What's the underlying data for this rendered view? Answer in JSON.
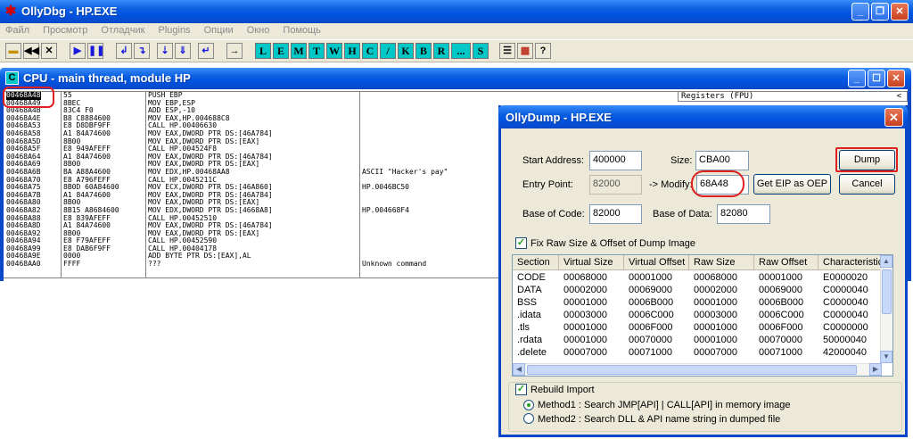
{
  "app": {
    "title": "OllyDbg - HP.EXE",
    "icon": "bug-icon"
  },
  "menu": [
    "Файл",
    "Просмотр",
    "Отладчик",
    "Plugins",
    "Опции",
    "Окно",
    "Помощь"
  ],
  "toolbar": {
    "letters": [
      "L",
      "E",
      "M",
      "T",
      "W",
      "H",
      "C",
      "/",
      "K",
      "B",
      "R",
      "...",
      "S"
    ]
  },
  "cpu_window": {
    "title": "CPU - main thread, module HP",
    "registers_header": "Registers (FPU)",
    "rows": [
      {
        "addr": "00468A48",
        "hex": "55",
        "asm": "PUSH EBP",
        "cmt": ""
      },
      {
        "addr": "00468A49",
        "hex": "8BEC",
        "asm": "MOV EBP,ESP",
        "cmt": ""
      },
      {
        "addr": "00468A4B",
        "hex": "83C4 F0",
        "asm": "ADD ESP,-10",
        "cmt": ""
      },
      {
        "addr": "00468A4E",
        "hex": "B8 C8884600",
        "asm": "MOV EAX,HP.004688C8",
        "cmt": ""
      },
      {
        "addr": "00468A53",
        "hex": "E8 D8DBF9FF",
        "asm": "CALL HP.00406630",
        "cmt": ""
      },
      {
        "addr": "00468A58",
        "hex": "A1 84A74600",
        "asm": "MOV EAX,DWORD PTR DS:[46A784]",
        "cmt": ""
      },
      {
        "addr": "00468A5D",
        "hex": "8B00",
        "asm": "MOV EAX,DWORD PTR DS:[EAX]",
        "cmt": ""
      },
      {
        "addr": "00468A5F",
        "hex": "E8 949AFEFF",
        "asm": "CALL HP.004524F8",
        "cmt": ""
      },
      {
        "addr": "00468A64",
        "hex": "A1 84A74600",
        "asm": "MOV EAX,DWORD PTR DS:[46A784]",
        "cmt": ""
      },
      {
        "addr": "00468A69",
        "hex": "8B00",
        "asm": "MOV EAX,DWORD PTR DS:[EAX]",
        "cmt": ""
      },
      {
        "addr": "00468A6B",
        "hex": "BA A88A4600",
        "asm": "MOV EDX,HP.00468AA8",
        "cmt": "ASCII \"Hacker's pay\""
      },
      {
        "addr": "00468A70",
        "hex": "E8 A796FEFF",
        "asm": "CALL HP.0045211C",
        "cmt": ""
      },
      {
        "addr": "00468A75",
        "hex": "8B0D 60A84600",
        "asm": "MOV ECX,DWORD PTR DS:[46A860]",
        "cmt": "HP.0046BC50"
      },
      {
        "addr": "00468A7B",
        "hex": "A1 84A74600",
        "asm": "MOV EAX,DWORD PTR DS:[46A784]",
        "cmt": ""
      },
      {
        "addr": "00468A80",
        "hex": "8B00",
        "asm": "MOV EAX,DWORD PTR DS:[EAX]",
        "cmt": ""
      },
      {
        "addr": "00468A82",
        "hex": "8B15 A8684600",
        "asm": "MOV EDX,DWORD PTR DS:[4668A8]",
        "cmt": "HP.004668F4"
      },
      {
        "addr": "00468A88",
        "hex": "E8 839AFEFF",
        "asm": "CALL HP.00452510",
        "cmt": ""
      },
      {
        "addr": "00468A8D",
        "hex": "A1 84A74600",
        "asm": "MOV EAX,DWORD PTR DS:[46A784]",
        "cmt": ""
      },
      {
        "addr": "00468A92",
        "hex": "8B00",
        "asm": "MOV EAX,DWORD PTR DS:[EAX]",
        "cmt": ""
      },
      {
        "addr": "00468A94",
        "hex": "E8 F79AFEFF",
        "asm": "CALL HP.00452590",
        "cmt": ""
      },
      {
        "addr": "00468A99",
        "hex": "E8 DAB6F9FF",
        "asm": "CALL HP.00404178",
        "cmt": ""
      },
      {
        "addr": "00468A9E",
        "hex": "0000",
        "asm": "ADD BYTE PTR DS:[EAX],AL",
        "cmt": ""
      },
      {
        "addr": "00468AA0",
        "hex": "FFFF",
        "asm": "???",
        "cmt": "Unknown command"
      }
    ]
  },
  "dump_dialog": {
    "title": "OllyDump - HP.EXE",
    "start_address_label": "Start Address:",
    "start_address": "400000",
    "size_label": "Size:",
    "size": "CBA00",
    "entry_point_label": "Entry Point:",
    "entry_point": "82000",
    "modify_label": "-> Modify:",
    "modify": "68A48",
    "base_of_code_label": "Base of Code:",
    "base_of_code": "82000",
    "base_of_data_label": "Base of Data:",
    "base_of_data": "82080",
    "dump_label": "Dump",
    "cancel_label": "Cancel",
    "get_eip_label": "Get EIP as OEP",
    "fix_raw_label": "Fix Raw Size & Offset of Dump Image",
    "fix_raw_checked": true,
    "columns": [
      "Section",
      "Virtual Size",
      "Virtual Offset",
      "Raw Size",
      "Raw Offset",
      "Characteristic"
    ],
    "sections": [
      [
        "CODE",
        "00068000",
        "00001000",
        "00068000",
        "00001000",
        "E0000020"
      ],
      [
        "DATA",
        "00002000",
        "00069000",
        "00002000",
        "00069000",
        "C0000040"
      ],
      [
        "BSS",
        "00001000",
        "0006B000",
        "00001000",
        "0006B000",
        "C0000040"
      ],
      [
        ".idata",
        "00003000",
        "0006C000",
        "00003000",
        "0006C000",
        "C0000040"
      ],
      [
        ".tls",
        "00001000",
        "0006F000",
        "00001000",
        "0006F000",
        "C0000000"
      ],
      [
        ".rdata",
        "00001000",
        "00070000",
        "00001000",
        "00070000",
        "50000040"
      ],
      [
        ".delete",
        "00007000",
        "00071000",
        "00007000",
        "00071000",
        "42000040"
      ]
    ],
    "rebuild_import_label": "Rebuild Import",
    "rebuild_import_checked": true,
    "method1_label": "Method1 : Search JMP[API] | CALL[API] in memory image",
    "method2_label": "Method2 : Search DLL & API name string in dumped file",
    "method_selected": "Method1"
  },
  "colors": {
    "titlebar": "#0054e3",
    "annotation_red": "#e02020",
    "selection": "#000000",
    "toolbar_letter_bg": "#00c8c8"
  }
}
